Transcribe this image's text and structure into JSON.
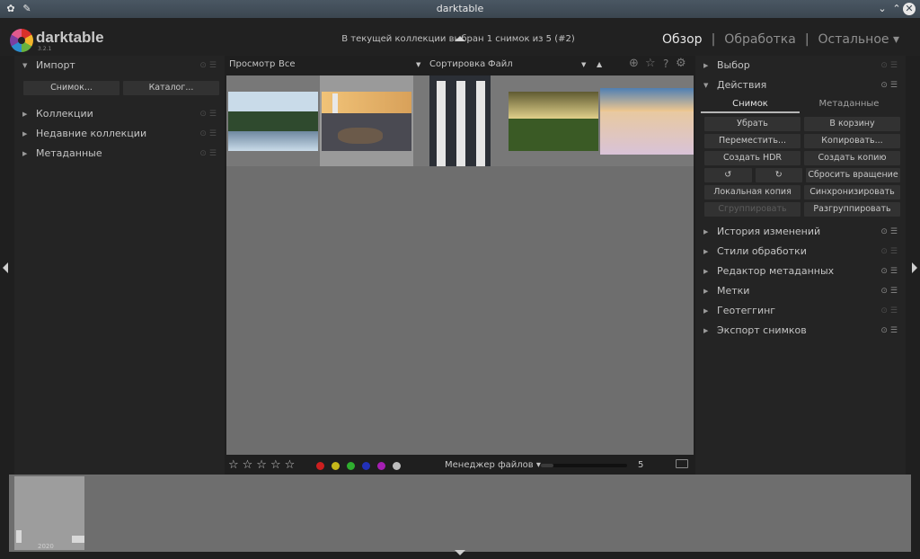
{
  "window": {
    "title": "darktable"
  },
  "header": {
    "logo": "darktable",
    "version": "3.2.1",
    "collection_info": "В текущей коллекции выбран 1 снимок из 5 (#2)"
  },
  "views": [
    {
      "label": "Обзор",
      "active": true
    },
    {
      "label": "Обработка",
      "active": false
    },
    {
      "label": "Остальное ▾",
      "active": false
    }
  ],
  "left_panel": {
    "import": {
      "title": "Импорт",
      "buttons": [
        "Снимок...",
        "Каталог..."
      ]
    },
    "sections": [
      "Коллекции",
      "Недавние коллекции",
      "Метаданные"
    ]
  },
  "toolbar": {
    "view_label": "Просмотр",
    "view_value": "Все",
    "sort_label": "Сортировка",
    "sort_value": "Файл"
  },
  "thumbnails": [
    {
      "colors": [
        "#c9dbe9",
        "#2f4a2e",
        "#6f88a0"
      ]
    },
    {
      "colors": [
        "#d8a15a",
        "#4a4a52",
        "#6b5a4a"
      ],
      "selected": true
    },
    {
      "colors": [
        "#e6e6e6",
        "#3a3a3a",
        "#1c2130"
      ]
    },
    {
      "colors": [
        "#b8a76f",
        "#3a5a25",
        "#5b6b3a"
      ]
    },
    {
      "colors": [
        "#4f7fb3",
        "#e8c9a0",
        "#d9c3d8"
      ]
    }
  ],
  "bottom_bar": {
    "rating_stars": "☆☆☆☆☆",
    "color_labels": [
      "#cc1f1f",
      "#c7b81a",
      "#2fae2f",
      "#2231b8",
      "#a51fb3",
      "#bdbdbd"
    ],
    "layout": "Менеджер файлов ▾",
    "zoom": 5,
    "zoom_fraction": 0.15
  },
  "right_panel": {
    "select_title": "Выбор",
    "actions_title": "Действия",
    "tabs": [
      "Снимок",
      "Метаданные"
    ],
    "action_rows": [
      [
        "Убрать",
        "В корзину"
      ],
      [
        "Переместить...",
        "Копировать..."
      ],
      [
        "Создать HDR",
        "Создать копию"
      ],
      [
        "↺",
        "↻",
        "Сбросить вращение"
      ],
      [
        "Локальная копия",
        "Синхронизировать"
      ],
      [
        "Сгруппировать",
        "Разгруппировать"
      ]
    ],
    "modules": [
      "История изменений",
      "Стили обработки",
      "Редактор метаданных",
      "Метки",
      "Геотеггинг",
      "Экспорт снимков"
    ]
  },
  "filmstrip": {
    "year": "2020"
  }
}
